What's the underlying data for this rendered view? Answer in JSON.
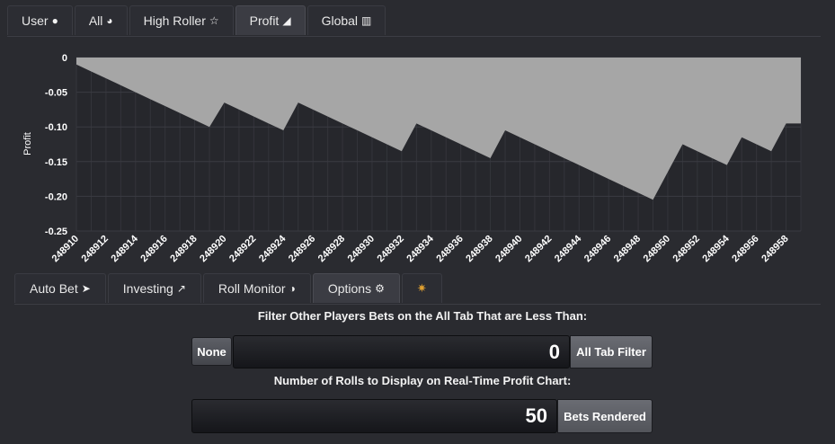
{
  "top_tabs": [
    {
      "label": "User",
      "icon": "user-icon",
      "glyph": "👤"
    },
    {
      "label": "All",
      "icon": "globe-icon",
      "glyph": "🌐"
    },
    {
      "label": "High Roller",
      "icon": "star-outline-icon",
      "glyph": "☆"
    },
    {
      "label": "Profit",
      "icon": "area-chart-icon",
      "glyph": "◺",
      "active": true
    },
    {
      "label": "Global",
      "icon": "bar-chart-icon",
      "glyph": "▥"
    }
  ],
  "chart_data": {
    "type": "area",
    "ylabel": "Profit",
    "xlabel": "",
    "title": "",
    "ylim": [
      -0.25,
      0
    ],
    "yticks": [
      "0",
      "-0.05",
      "-0.10",
      "-0.15",
      "-0.20",
      "-0.25"
    ],
    "xtick_labels": [
      "248910",
      "248912",
      "248914",
      "248916",
      "248918",
      "248920",
      "248922",
      "248924",
      "248926",
      "248928",
      "248930",
      "248932",
      "248934",
      "248936",
      "248938",
      "248940",
      "248942",
      "248944",
      "248946",
      "248948",
      "248950",
      "248952",
      "248954",
      "248956",
      "248958"
    ],
    "x": [
      248910,
      248911,
      248912,
      248913,
      248914,
      248915,
      248916,
      248917,
      248918,
      248919,
      248920,
      248921,
      248922,
      248923,
      248924,
      248925,
      248926,
      248927,
      248928,
      248929,
      248930,
      248931,
      248932,
      248933,
      248934,
      248935,
      248936,
      248937,
      248938,
      248939,
      248940,
      248941,
      248942,
      248943,
      248944,
      248945,
      248946,
      248947,
      248948,
      248949,
      248950,
      248951,
      248952,
      248953,
      248954,
      248955,
      248956,
      248957,
      248958,
      248959
    ],
    "y": [
      -0.01,
      -0.02,
      -0.03,
      -0.04,
      -0.05,
      -0.06,
      -0.07,
      -0.08,
      -0.09,
      -0.1,
      -0.065,
      -0.075,
      -0.085,
      -0.095,
      -0.105,
      -0.065,
      -0.075,
      -0.085,
      -0.095,
      -0.105,
      -0.115,
      -0.125,
      -0.135,
      -0.095,
      -0.105,
      -0.115,
      -0.125,
      -0.135,
      -0.145,
      -0.105,
      -0.115,
      -0.125,
      -0.135,
      -0.145,
      -0.155,
      -0.165,
      -0.175,
      -0.185,
      -0.195,
      -0.205,
      -0.165,
      -0.125,
      -0.135,
      -0.145,
      -0.155,
      -0.115,
      -0.125,
      -0.135,
      -0.095,
      -0.095
    ],
    "fill_color": "#a6a6a6",
    "grid": true
  },
  "bottom_tabs": [
    {
      "label": "Auto Bet",
      "icon": "rocket-icon",
      "glyph": "🚀"
    },
    {
      "label": "Investing",
      "icon": "line-chart-icon",
      "glyph": "📈"
    },
    {
      "label": "Roll Monitor",
      "icon": "dashboard-icon",
      "glyph": "⏲"
    },
    {
      "label": "Options",
      "icon": "gear-icon",
      "glyph": "⚙",
      "active": true
    },
    {
      "label": "",
      "icon": "star-burst-icon",
      "glyph": "✷"
    }
  ],
  "filter": {
    "heading": "Filter Other Players Bets on the All Tab That are Less Than:",
    "none_label": "None",
    "value": "0",
    "addon_label": "All Tab Filter"
  },
  "rolls": {
    "heading": "Number of Rolls to Display on Real-Time Profit Chart:",
    "value": "50",
    "addon_label": "Bets Rendered"
  }
}
